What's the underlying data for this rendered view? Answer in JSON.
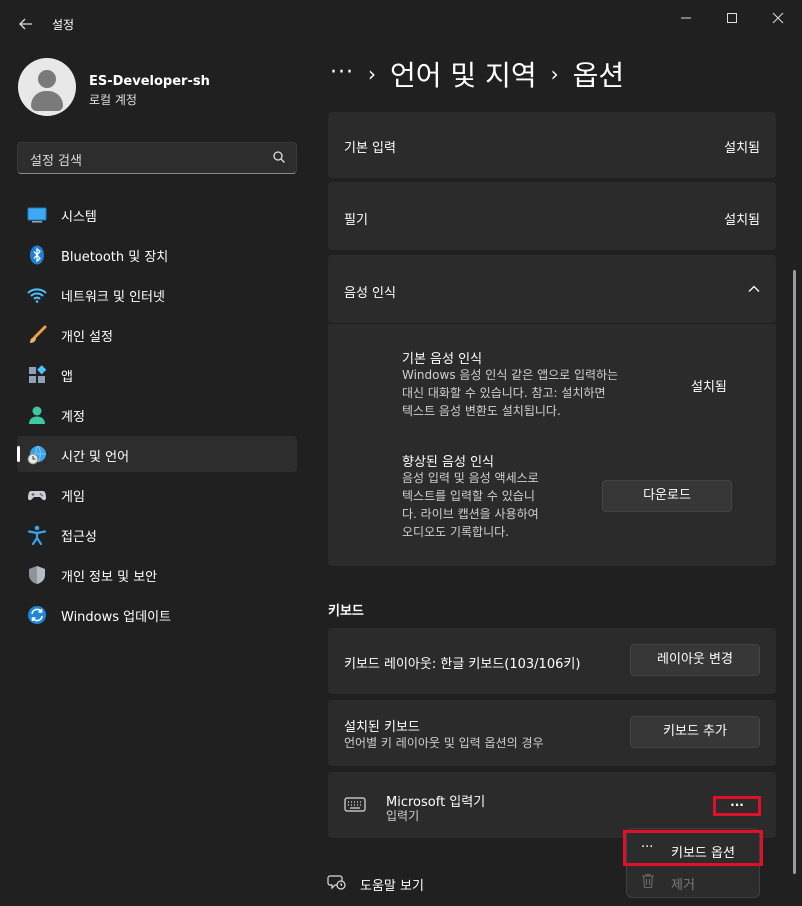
{
  "window": {
    "title": "설정",
    "back_icon": "arrow-left-icon",
    "minimize_glyph": "—",
    "maximize_glyph": "☐",
    "close_glyph": "✕"
  },
  "profile": {
    "name": "ES-Developer-sh",
    "account_type": "로컬 계정"
  },
  "search": {
    "placeholder": "설정 검색"
  },
  "sidebar": {
    "items": [
      {
        "label": "시스템",
        "icon": "system-icon"
      },
      {
        "label": "Bluetooth 및 장치",
        "icon": "bluetooth-icon"
      },
      {
        "label": "네트워크 및 인터넷",
        "icon": "wifi-icon"
      },
      {
        "label": "개인 설정",
        "icon": "brush-icon"
      },
      {
        "label": "앱",
        "icon": "apps-icon"
      },
      {
        "label": "계정",
        "icon": "account-icon"
      },
      {
        "label": "시간 및 언어",
        "icon": "time-language-icon",
        "active": true
      },
      {
        "label": "게임",
        "icon": "gamepad-icon"
      },
      {
        "label": "접근성",
        "icon": "accessibility-icon"
      },
      {
        "label": "개인 정보 및 보안",
        "icon": "shield-icon"
      },
      {
        "label": "Windows 업데이트",
        "icon": "update-icon"
      }
    ]
  },
  "breadcrumb": {
    "overflow": "···",
    "sep": "›",
    "parent": "언어 및 지역",
    "current": "옵션"
  },
  "features": {
    "basic_input": {
      "label": "기본 입력",
      "status": "설치됨"
    },
    "handwriting": {
      "label": "필기",
      "status": "설치됨"
    },
    "speech": {
      "label": "음성 인식",
      "basic": {
        "title": "기본 음성 인식",
        "desc_lines": [
          "Windows 음성 인식 같은 앱으로 입력하는",
          "대신 대화할 수 있습니다. 참고: 설치하면",
          "텍스트 음성 변환도 설치됩니다."
        ],
        "status": "설치됨"
      },
      "enhanced": {
        "title": "향상된 음성 인식",
        "desc_lines": [
          "음성 입력 및 음성 액세스로",
          "텍스트를 입력할 수 있습니",
          "다. 라이브 캡션을 사용하여",
          "오디오도 기록합니다."
        ],
        "button": "다운로드"
      }
    }
  },
  "keyboard": {
    "header": "키보드",
    "layout_label": "키보드 레이아웃: 한글 키보드(103/106키)",
    "layout_button": "레이아웃 변경",
    "installed_title": "설치된 키보드",
    "installed_desc": "언어별 키 레이아웃 및 입력 옵션의 경우",
    "add_button": "키보드 추가",
    "ime_name": "Microsoft 입력기",
    "ime_sub": "입력기",
    "more_glyph": "···"
  },
  "context_menu": {
    "options": "키보드 옵션",
    "options_glyph": "···",
    "remove": "제거"
  },
  "help": {
    "label": "도움말 보기"
  },
  "colors": {
    "accent": "#4cc2ff",
    "highlight": "#e0102a",
    "background": "#202020",
    "card": "#2b2b2b"
  }
}
